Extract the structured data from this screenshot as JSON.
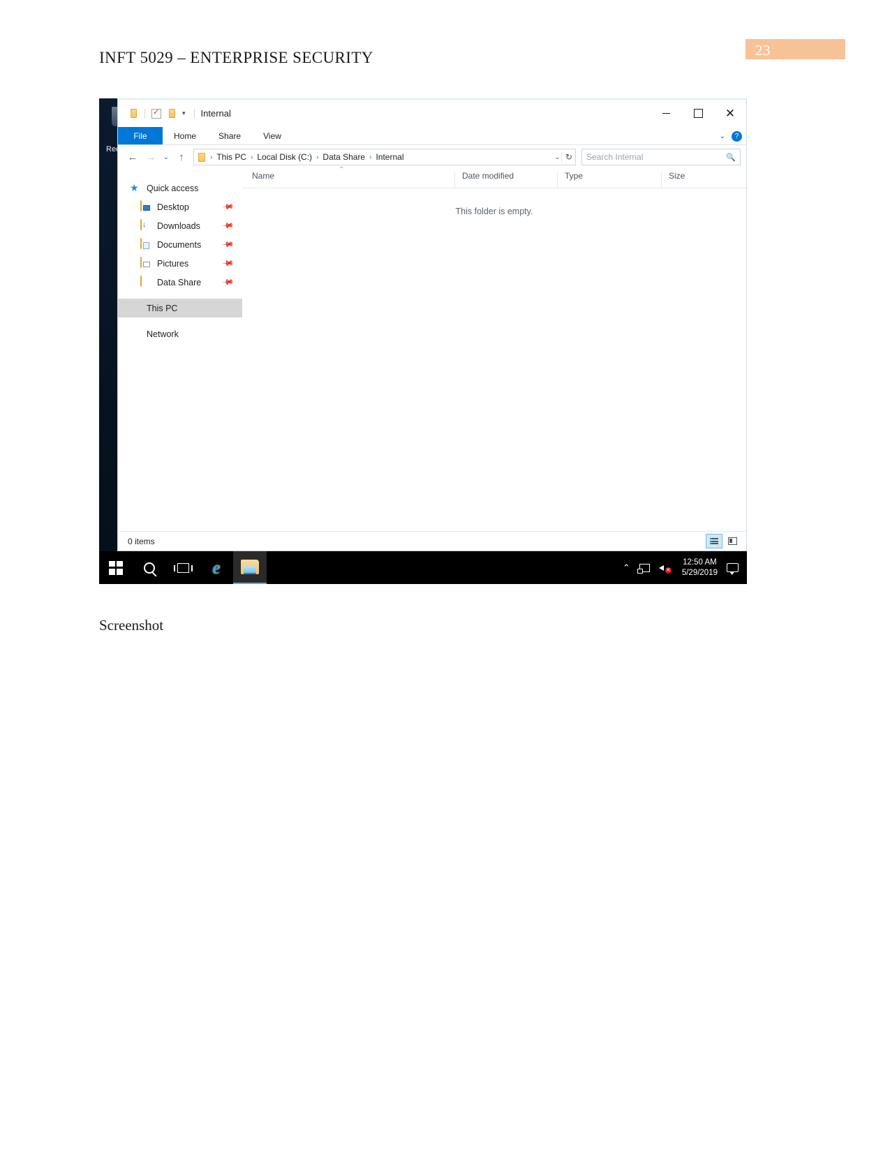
{
  "document": {
    "title": "INFT 5029 – ENTERPRISE SECURITY",
    "page_number": "23",
    "caption": "Screenshot",
    "accent_color": "#f7c396"
  },
  "desktop": {
    "recycle_bin_label": "Rec"
  },
  "explorer": {
    "titlebar": {
      "title": "Internal",
      "quick_access": [
        "folder-icon",
        "properties-icon",
        "new-folder-icon"
      ],
      "dropdown_caret": "▾",
      "minimize": "—",
      "maximize": "▢",
      "close": "✕"
    },
    "ribbon": {
      "tabs": [
        {
          "label": "File",
          "active": true
        },
        {
          "label": "Home",
          "active": false
        },
        {
          "label": "Share",
          "active": false
        },
        {
          "label": "View",
          "active": false
        }
      ],
      "collapse_caret": "⌄",
      "help_label": "?"
    },
    "address": {
      "back": "←",
      "forward": "→",
      "recent": "⌄",
      "up": "↑",
      "breadcrumbs": [
        "This PC",
        "Local Disk (C:)",
        "Data Share",
        "Internal"
      ],
      "separator": "›",
      "dropdown_caret": "⌄",
      "refresh": "↻"
    },
    "search": {
      "placeholder": "Search Internal",
      "icon": "search-icon"
    },
    "navpane": {
      "items": [
        {
          "label": "Quick access",
          "icon": "star-icon",
          "level": 0,
          "pinned": false,
          "selected": false
        },
        {
          "label": "Desktop",
          "icon": "folder-desktop-icon",
          "level": 1,
          "pinned": true,
          "selected": false
        },
        {
          "label": "Downloads",
          "icon": "folder-downloads-icon",
          "level": 1,
          "pinned": true,
          "selected": false
        },
        {
          "label": "Documents",
          "icon": "folder-documents-icon",
          "level": 1,
          "pinned": true,
          "selected": false
        },
        {
          "label": "Pictures",
          "icon": "folder-pictures-icon",
          "level": 1,
          "pinned": true,
          "selected": false
        },
        {
          "label": "Data Share",
          "icon": "folder-icon",
          "level": 1,
          "pinned": true,
          "selected": false
        },
        {
          "label": "This PC",
          "icon": "this-pc-icon",
          "level": 0,
          "pinned": false,
          "selected": true
        },
        {
          "label": "Network",
          "icon": "network-icon",
          "level": 0,
          "pinned": false,
          "selected": false
        }
      ],
      "pin_glyph": "📌"
    },
    "columns": [
      {
        "label": "Name",
        "sorted": true,
        "sort_caret": "⌃"
      },
      {
        "label": "Date modified",
        "sorted": false
      },
      {
        "label": "Type",
        "sorted": false
      },
      {
        "label": "Size",
        "sorted": false
      }
    ],
    "file_rows": [],
    "empty_message": "This folder is empty.",
    "statusbar": {
      "item_count": "0 items",
      "views": [
        {
          "name": "details-view",
          "active": true
        },
        {
          "name": "tiles-view",
          "active": false
        }
      ]
    }
  },
  "taskbar": {
    "buttons": [
      {
        "name": "start-button",
        "icon": "windows-logo-icon",
        "active": false
      },
      {
        "name": "search-button",
        "icon": "search-icon",
        "active": false
      },
      {
        "name": "task-view-button",
        "icon": "task-view-icon",
        "active": false
      },
      {
        "name": "internet-explorer-button",
        "icon": "internet-explorer-icon",
        "active": false
      },
      {
        "name": "file-explorer-button",
        "icon": "file-explorer-icon",
        "active": true
      }
    ],
    "tray": {
      "show_hidden": "⌃",
      "network_icon": "network-icon",
      "volume_icon": "speaker-muted-icon",
      "mute_mark": "✕",
      "time": "12:50 AM",
      "date": "5/29/2019",
      "action_center_icon": "action-center-icon"
    }
  }
}
